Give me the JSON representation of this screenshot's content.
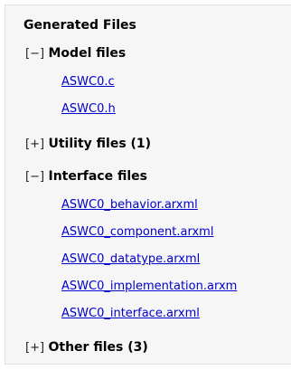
{
  "title": "Generated Files",
  "groups": [
    {
      "toggle": "[−]",
      "label": "Model files",
      "files": [
        "ASWC0.c",
        "ASWC0.h"
      ]
    },
    {
      "toggle": "[+]",
      "label": "Utility files (1)",
      "files": []
    },
    {
      "toggle": "[−]",
      "label": "Interface files",
      "files": [
        "ASWC0_behavior.arxml",
        "ASWC0_component.arxml",
        "ASWC0_datatype.arxml",
        "ASWC0_implementation.arxm",
        "ASWC0_interface.arxml"
      ]
    },
    {
      "toggle": "[+]",
      "label": "Other files (3)",
      "files": []
    }
  ],
  "colors": {
    "link": "#0000cc",
    "panel_background": "#f6f6f6"
  }
}
